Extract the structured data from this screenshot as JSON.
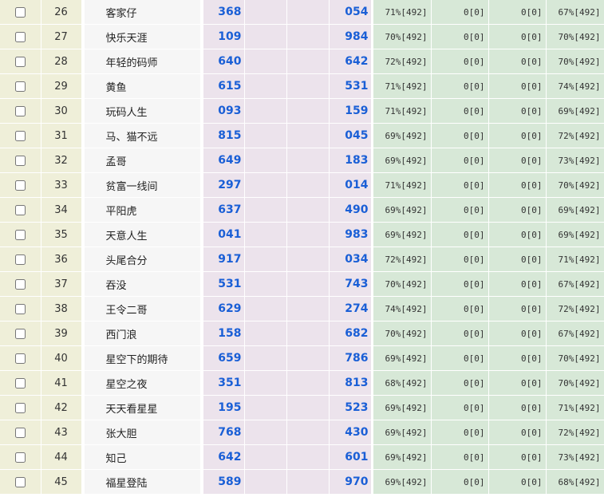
{
  "rows": [
    {
      "no": "26",
      "name": "客家仔",
      "a": "368",
      "b": "054",
      "p1": "71%[492]",
      "p2": "0[0]",
      "p3": "0[0]",
      "p4": "67%[492]"
    },
    {
      "no": "27",
      "name": "快乐天涯",
      "a": "109",
      "b": "984",
      "p1": "70%[492]",
      "p2": "0[0]",
      "p3": "0[0]",
      "p4": "70%[492]"
    },
    {
      "no": "28",
      "name": "年轻的码师",
      "a": "640",
      "b": "642",
      "p1": "72%[492]",
      "p2": "0[0]",
      "p3": "0[0]",
      "p4": "70%[492]"
    },
    {
      "no": "29",
      "name": "黄鱼",
      "a": "615",
      "b": "531",
      "p1": "71%[492]",
      "p2": "0[0]",
      "p3": "0[0]",
      "p4": "74%[492]"
    },
    {
      "no": "30",
      "name": "玩码人生",
      "a": "093",
      "b": "159",
      "p1": "71%[492]",
      "p2": "0[0]",
      "p3": "0[0]",
      "p4": "69%[492]"
    },
    {
      "no": "31",
      "name": "马、猫不远",
      "a": "815",
      "b": "045",
      "p1": "69%[492]",
      "p2": "0[0]",
      "p3": "0[0]",
      "p4": "72%[492]"
    },
    {
      "no": "32",
      "name": "孟哥",
      "a": "649",
      "b": "183",
      "p1": "69%[492]",
      "p2": "0[0]",
      "p3": "0[0]",
      "p4": "73%[492]"
    },
    {
      "no": "33",
      "name": "贫富一线间",
      "a": "297",
      "b": "014",
      "p1": "71%[492]",
      "p2": "0[0]",
      "p3": "0[0]",
      "p4": "70%[492]"
    },
    {
      "no": "34",
      "name": "平阳虎",
      "a": "637",
      "b": "490",
      "p1": "69%[492]",
      "p2": "0[0]",
      "p3": "0[0]",
      "p4": "69%[492]"
    },
    {
      "no": "35",
      "name": "天意人生",
      "a": "041",
      "b": "983",
      "p1": "69%[492]",
      "p2": "0[0]",
      "p3": "0[0]",
      "p4": "69%[492]"
    },
    {
      "no": "36",
      "name": "头尾合分",
      "a": "917",
      "b": "034",
      "p1": "72%[492]",
      "p2": "0[0]",
      "p3": "0[0]",
      "p4": "71%[492]"
    },
    {
      "no": "37",
      "name": "吞没",
      "a": "531",
      "b": "743",
      "p1": "70%[492]",
      "p2": "0[0]",
      "p3": "0[0]",
      "p4": "67%[492]"
    },
    {
      "no": "38",
      "name": "王令二哥",
      "a": "629",
      "b": "274",
      "p1": "74%[492]",
      "p2": "0[0]",
      "p3": "0[0]",
      "p4": "72%[492]"
    },
    {
      "no": "39",
      "name": "西门浪",
      "a": "158",
      "b": "682",
      "p1": "70%[492]",
      "p2": "0[0]",
      "p3": "0[0]",
      "p4": "67%[492]"
    },
    {
      "no": "40",
      "name": "星空下的期待",
      "a": "659",
      "b": "786",
      "p1": "69%[492]",
      "p2": "0[0]",
      "p3": "0[0]",
      "p4": "70%[492]"
    },
    {
      "no": "41",
      "name": "星空之夜",
      "a": "351",
      "b": "813",
      "p1": "68%[492]",
      "p2": "0[0]",
      "p3": "0[0]",
      "p4": "70%[492]"
    },
    {
      "no": "42",
      "name": "天天看星星",
      "a": "195",
      "b": "523",
      "p1": "69%[492]",
      "p2": "0[0]",
      "p3": "0[0]",
      "p4": "71%[492]"
    },
    {
      "no": "43",
      "name": "张大胆",
      "a": "768",
      "b": "430",
      "p1": "69%[492]",
      "p2": "0[0]",
      "p3": "0[0]",
      "p4": "72%[492]"
    },
    {
      "no": "44",
      "name": "知己",
      "a": "642",
      "b": "601",
      "p1": "69%[492]",
      "p2": "0[0]",
      "p3": "0[0]",
      "p4": "73%[492]"
    },
    {
      "no": "45",
      "name": "福星登陆",
      "a": "589",
      "b": "970",
      "p1": "69%[492]",
      "p2": "0[0]",
      "p3": "0[0]",
      "p4": "68%[492]"
    }
  ]
}
